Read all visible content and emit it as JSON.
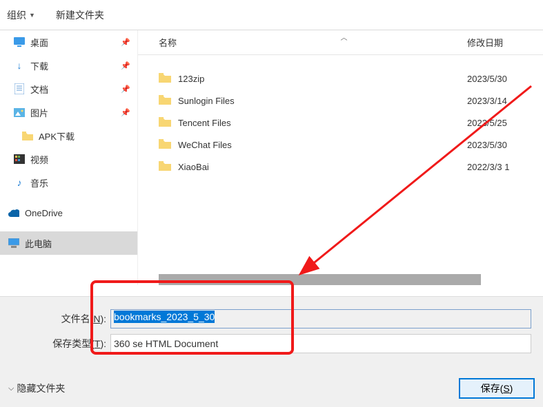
{
  "toolbar": {
    "organize": "组织",
    "new_folder": "新建文件夹"
  },
  "sidebar": {
    "items": [
      {
        "label": "桌面",
        "icon": "desktop",
        "pinned": true
      },
      {
        "label": "下载",
        "icon": "download",
        "pinned": true
      },
      {
        "label": "文档",
        "icon": "document",
        "pinned": true
      },
      {
        "label": "图片",
        "icon": "picture",
        "pinned": true
      },
      {
        "label": "APK下载",
        "icon": "folder",
        "pinned": false,
        "sub": true
      },
      {
        "label": "视频",
        "icon": "video",
        "pinned": false
      },
      {
        "label": "音乐",
        "icon": "music",
        "pinned": false
      },
      {
        "label": "OneDrive",
        "icon": "onedrive",
        "pinned": false
      },
      {
        "label": "此电脑",
        "icon": "pc",
        "pinned": false,
        "selected": true
      }
    ]
  },
  "filelist": {
    "columns": {
      "name": "名称",
      "date": "修改日期"
    },
    "rows": [
      {
        "name": "123zip",
        "date": "2023/5/30"
      },
      {
        "name": "Sunlogin Files",
        "date": "2023/3/14"
      },
      {
        "name": "Tencent Files",
        "date": "2023/5/25"
      },
      {
        "name": "WeChat Files",
        "date": "2023/5/30"
      },
      {
        "name": "XiaoBai",
        "date": "2022/3/3 1"
      }
    ]
  },
  "form": {
    "filename_label_pre": "文件名(",
    "filename_label_key": "N",
    "filename_label_post": "):",
    "filename_value": "bookmarks_2023_5_30",
    "filetype_label_pre": "保存类型(",
    "filetype_label_key": "T",
    "filetype_label_post": "):",
    "filetype_value": "360 se HTML Document"
  },
  "bottom": {
    "hide_folders": "隐藏文件夹",
    "save_btn": "保存(S)"
  }
}
